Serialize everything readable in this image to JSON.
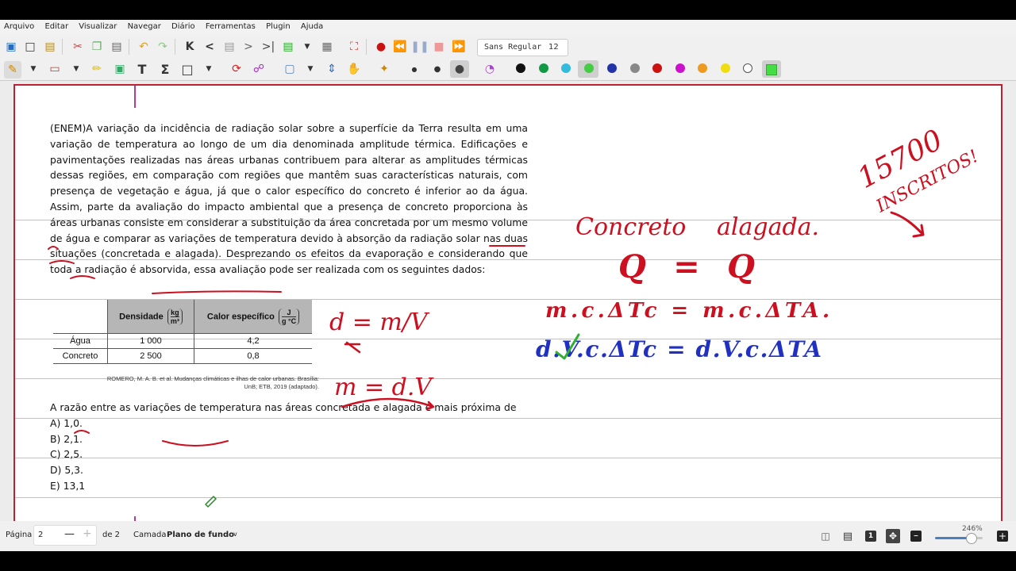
{
  "menu": [
    "Arquivo",
    "Editar",
    "Visualizar",
    "Navegar",
    "Diário",
    "Ferramentas",
    "Plugin",
    "Ajuda"
  ],
  "font": {
    "name": "Sans Regular",
    "size": "12"
  },
  "colors": {
    "accent_red": "#c02030",
    "ink_red": "#cc1020",
    "ink_blue": "#2030c0",
    "ink_green": "#30b030",
    "rule": "#a9c8e3"
  },
  "palette": [
    "#111111",
    "#119944",
    "#33bbdd",
    "#44cc44",
    "#2233aa",
    "#888888",
    "#cc1111",
    "#cc11cc",
    "#ee9922",
    "#eedd11",
    "#ffffff",
    "#44dd44"
  ],
  "question": {
    "intro": "(ENEM)A variação da incidência de radiação solar sobre a superfície da Terra resulta em uma variação de temperatura ao longo de um dia denominada amplitude térmica. Edificações e pavimentações realizadas nas áreas urbanas contribuem para alterar as amplitudes térmicas dessas regiões, em comparação com regiões que mantêm suas características naturais, com presença de vegetação e água, já que o calor específico do concreto é inferior ao da água. Assim, parte da avaliação do impacto ambiental que a presença de concreto proporciona às áreas urbanas consiste em considerar a substituição da área concretada por um mesmo volume de água e comparar as variações de temperatura devido à absorção da radiação solar nas duas situações (concretada e alagada). Desprezando os efeitos da evaporação e considerando que toda a radiação é absorvida, essa avaliação pode ser realizada com os seguintes dados:",
    "table": {
      "headers": [
        "",
        "Densidade",
        "Calor específico"
      ],
      "units": [
        "kg",
        "m³",
        "J",
        "g °C"
      ],
      "rows": [
        [
          "Água",
          "1 000",
          "4,2"
        ],
        [
          "Concreto",
          "2 500",
          "0,8"
        ]
      ]
    },
    "source": "ROMERO, M. A. B. et al. Mudanças climáticas e ilhas de calor urbanas. Brasília: UnB; ETB, 2019 (adaptado).",
    "prompt": "A razão entre as variações de temperatura nas áreas concretada e alagada é mais próxima de",
    "options": [
      "A) 1,0.",
      "B) 2,1.",
      "C) 2,5.",
      "D) 5,3.",
      "E) 13,1"
    ]
  },
  "handwriting": {
    "inscritos_count": "15700",
    "inscritos_label": "INSCRITOS!",
    "concreto": "Concreto",
    "alagada": "alagada.",
    "q_line": "Q = Q",
    "eq1": "m.c.ΔTc = m.c.ΔTA.",
    "eq2": "d.V.c.ΔTc = d.V.c.ΔTA",
    "density_formula": "d = m/V",
    "mass_formula": "m = d.V"
  },
  "status": {
    "page_label": "Página",
    "page_value": "2",
    "of_label": "de 2",
    "layer_label": "Camada",
    "layer_value": "Plano de fundo",
    "zoom": "246%"
  }
}
